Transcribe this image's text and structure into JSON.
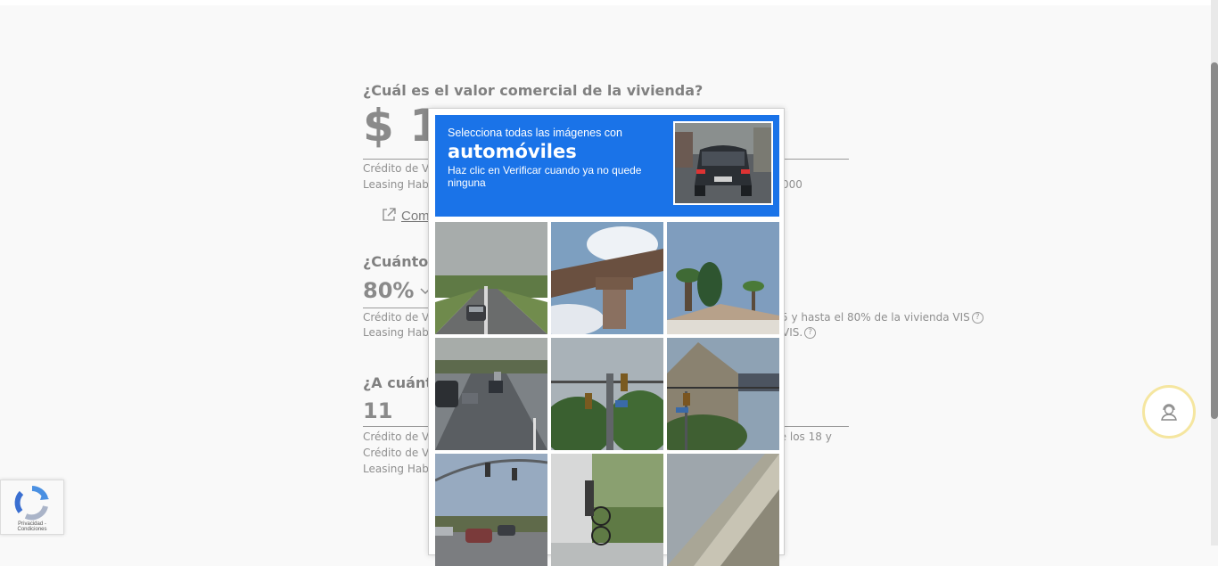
{
  "form": {
    "q1": "¿Cuál es el valor comercial de la vivienda?",
    "q1_value": "$ 1",
    "q1_note1": "Crédito de Viv",
    "q1_note2": "Leasing Habit",
    "q1_note2_tail": "000",
    "compare_link": "Com",
    "q2": "¿Cuánto d",
    "q2_value": "80%",
    "q2_note1": "Crédito de Viv",
    "q2_note1_tail": "5 y hasta el 80% de la vivienda VIS",
    "q2_note2": "Leasing Habit",
    "q2_note2_tail": "VIS.",
    "q3": "¿A cuánto",
    "q3_value": "11",
    "q3_note1": "Crédito de Viv",
    "q3_note1_tail": "re los 18 y",
    "q3_note2": "Crédito de Viv",
    "q3_note3": "Leasing Habit"
  },
  "captcha": {
    "instruction": "Selecciona todas las imágenes con",
    "target": "automóviles",
    "hint": "Haz clic en Verificar cuando ya no quede ninguna",
    "tiles": [
      {
        "label": "highway with car"
      },
      {
        "label": "overpass underside"
      },
      {
        "label": "palm trees house"
      },
      {
        "label": "highway traffic"
      },
      {
        "label": "traffic lights trees"
      },
      {
        "label": "house roof traffic light"
      },
      {
        "label": "intersection with cars"
      },
      {
        "label": "building bicycle"
      },
      {
        "label": "bridge underside"
      }
    ]
  },
  "badge": {
    "text": "Privacidad - Condiciones"
  }
}
